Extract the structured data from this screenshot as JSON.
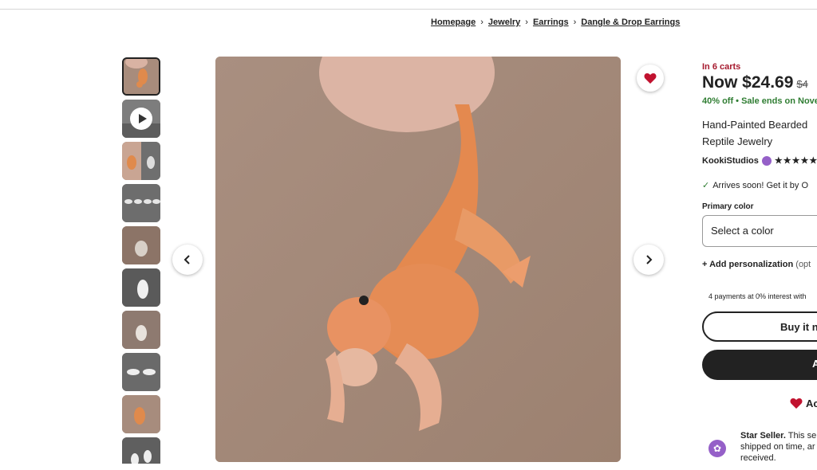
{
  "breadcrumb": [
    "Homepage",
    "Jewelry",
    "Earrings",
    "Dangle & Drop Earrings"
  ],
  "thumbnails": [
    "photo",
    "video",
    "photo",
    "photo",
    "photo",
    "photo",
    "photo",
    "photo",
    "photo",
    "photo"
  ],
  "listing": {
    "carts": "In 6 carts",
    "price": "Now $24.69",
    "original_price": "$4",
    "discount": "40% off",
    "sale_ends": "Sale ends on Nove",
    "title_line1": "Hand-Painted Bearded",
    "title_line2": "Reptile Jewelry",
    "seller": "KookiStudios",
    "stars": "★★★★★",
    "arrives": "Arrives soon! Get it by O",
    "primary_color_label": "Primary color",
    "select_placeholder": "Select a color",
    "personalization": "Add personalization",
    "personalization_opt": "(opt",
    "payments": "4 payments at 0% interest with",
    "buy_now": "Buy it n",
    "add_to_cart": "A",
    "add_to_collection": "Ac",
    "star_seller_title": "Star Seller.",
    "star_seller_text": "This sel shipped on time, ar received."
  },
  "colors": {
    "heart": "#c1122f",
    "star_seller": "#9560c8",
    "sale_green": "#2f7d32",
    "carts_red": "#a61a2e"
  }
}
